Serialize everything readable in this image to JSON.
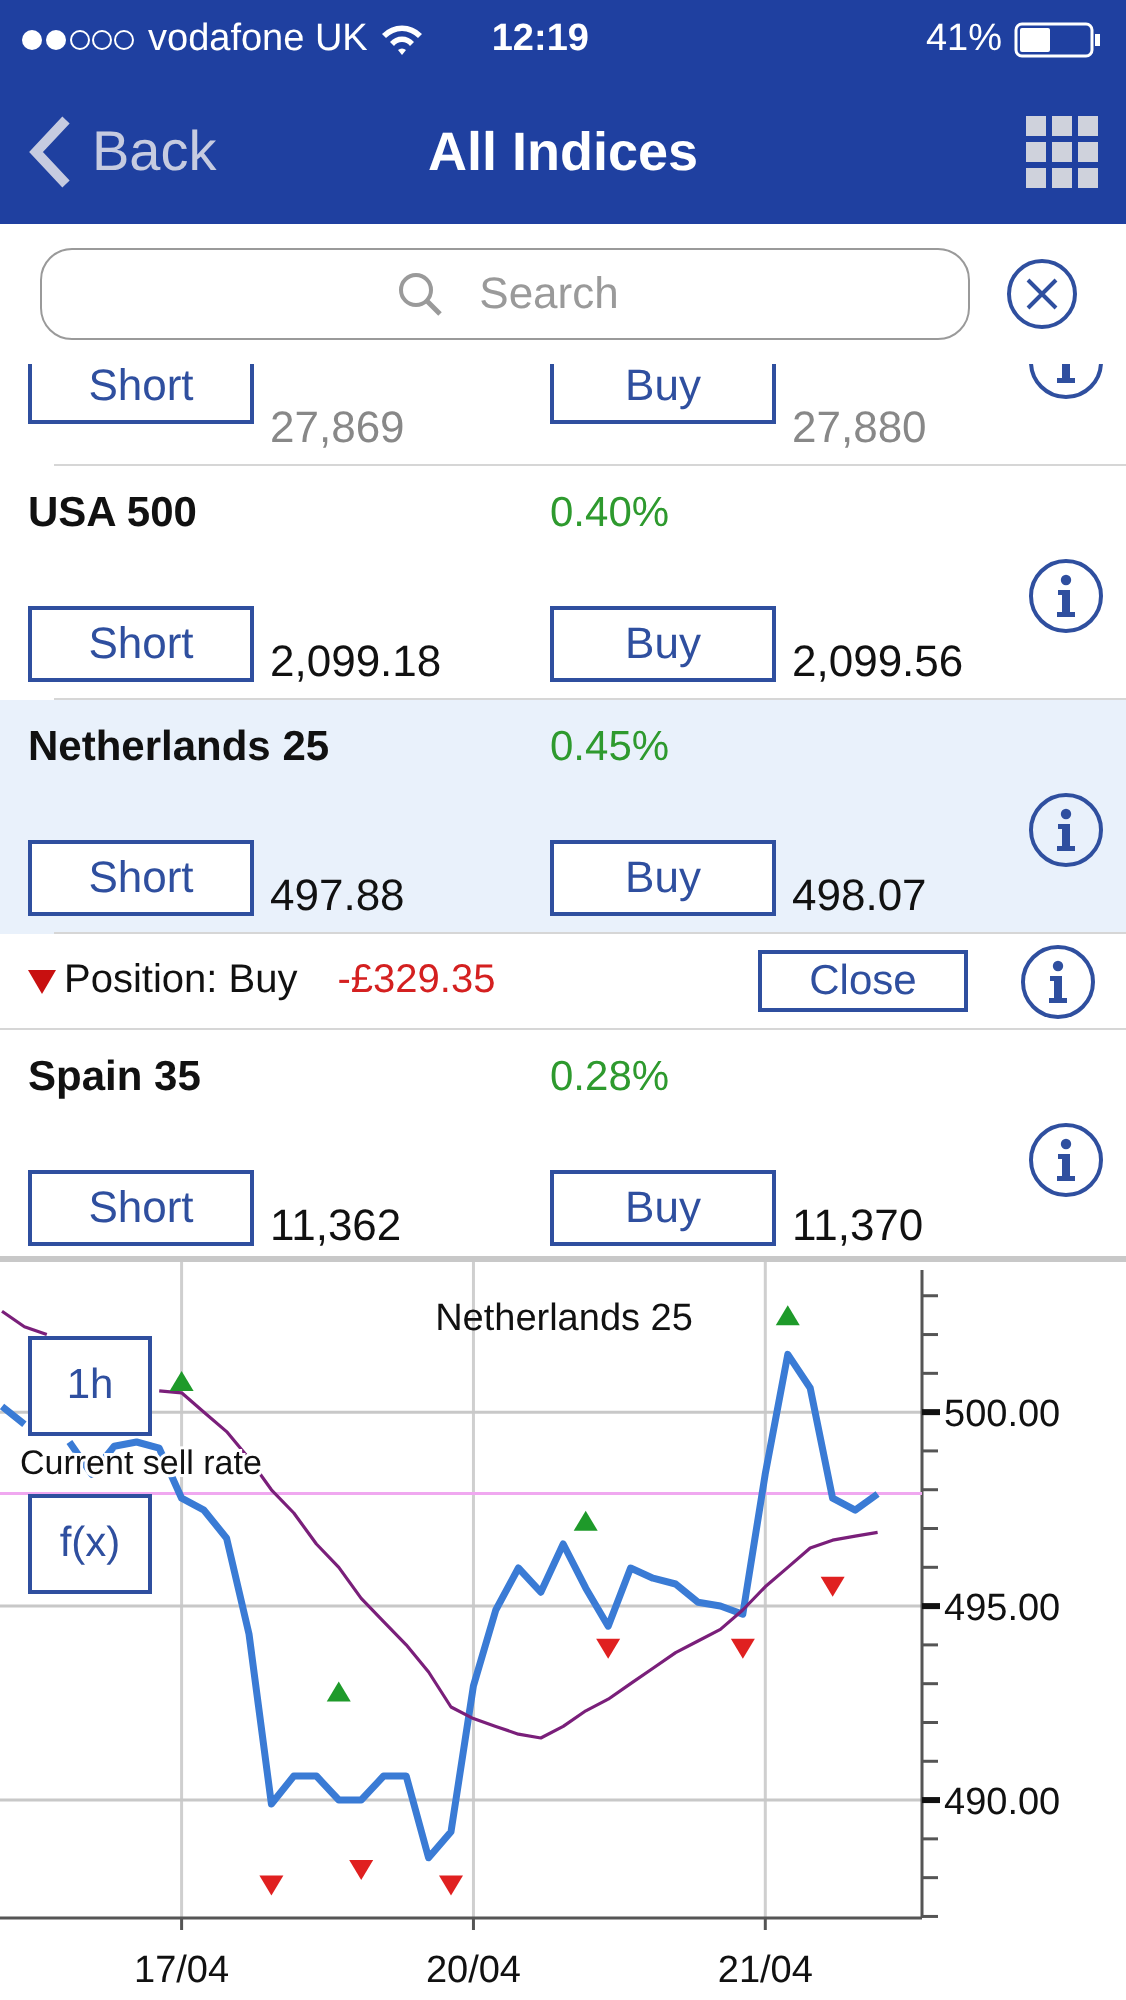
{
  "status_bar": {
    "carrier": "vodafone UK",
    "time": "12:19",
    "battery": "41%"
  },
  "nav": {
    "back": "Back",
    "title": "All Indices"
  },
  "search": {
    "placeholder": "Search"
  },
  "markets": [
    {
      "kind": "market",
      "selected": false,
      "short": "Short",
      "short_price": "27,869",
      "buy": "Buy",
      "buy_price": "27,880",
      "stale": true
    },
    {
      "kind": "market",
      "selected": false,
      "name": "USA 500",
      "change": "0.40%",
      "short": "Short",
      "short_price": "2,099.18",
      "buy": "Buy",
      "buy_price": "2,099.56",
      "stale": false
    },
    {
      "kind": "market",
      "selected": true,
      "name": "Netherlands 25",
      "change": "0.45%",
      "short": "Short",
      "short_price": "497.88",
      "buy": "Buy",
      "buy_price": "498.07",
      "stale": false
    },
    {
      "kind": "position",
      "selected": false,
      "label": "Position: Buy",
      "pnl": "-£329.35",
      "close": "Close"
    },
    {
      "kind": "market",
      "selected": false,
      "name": "Spain 35",
      "change": "0.28%",
      "short": "Short",
      "short_price": "11,362",
      "buy": "Buy",
      "buy_price": "11,370",
      "stale": false
    }
  ],
  "chart": {
    "buttons": [
      "1h",
      "f(x)"
    ],
    "chart_data": {
      "type": "line",
      "title": "Netherlands 25",
      "categories": [
        null,
        null,
        null,
        null,
        null,
        null,
        null,
        null,
        "17/04",
        null,
        null,
        null,
        null,
        null,
        null,
        null,
        null,
        null,
        null,
        null,
        null,
        "20/04",
        null,
        null,
        null,
        null,
        null,
        null,
        null,
        null,
        null,
        null,
        null,
        null,
        "21/04",
        null,
        null,
        null,
        null,
        null
      ],
      "series": [
        {
          "color": "#3a7bd5",
          "values": [
            500.15,
            499.69,
            null,
            499.23,
            498.4,
            499.12,
            499.23,
            499.07,
            497.78,
            497.47,
            496.75,
            494.28,
            489.9,
            490.62,
            490.62,
            490.0,
            490.0,
            490.62,
            490.62,
            488.51,
            489.18,
            492.94,
            494.9,
            495.98,
            495.36,
            496.6,
            495.46,
            494.48,
            495.98,
            495.72,
            495.57,
            495.1,
            495.0,
            494.79,
            498.4,
            501.49,
            500.62,
            497.78,
            497.47,
            497.89
          ]
        },
        {
          "color": "#7a1f7a",
          "values": [
            502.6,
            502.2,
            502.0,
            null,
            null,
            null,
            null,
            500.55,
            500.5,
            500.0,
            499.5,
            498.8,
            498.0,
            497.4,
            496.6,
            496.0,
            495.2,
            494.6,
            494.0,
            493.3,
            492.4,
            492.1,
            491.9,
            491.7,
            491.6,
            491.9,
            492.3,
            492.6,
            493.0,
            493.4,
            493.8,
            494.1,
            494.4,
            494.9,
            495.5,
            496.0,
            496.5,
            496.7,
            496.8,
            496.9
          ]
        },
        {
          "type": "scatter",
          "color": "#1e9a2a",
          "values": [
            null,
            null,
            null,
            null,
            null,
            null,
            null,
            null,
            500.8,
            null,
            null,
            null,
            null,
            null,
            null,
            492.8,
            null,
            null,
            null,
            null,
            null,
            null,
            null,
            null,
            null,
            null,
            497.2,
            null,
            null,
            null,
            null,
            null,
            null,
            null,
            null,
            502.5,
            null,
            null,
            null,
            null
          ]
        },
        {
          "type": "scatter",
          "color": "#e02020",
          "values": [
            null,
            null,
            null,
            null,
            null,
            null,
            null,
            null,
            null,
            null,
            null,
            null,
            487.8,
            null,
            null,
            null,
            488.2,
            null,
            null,
            null,
            487.8,
            null,
            null,
            null,
            null,
            null,
            null,
            493.9,
            null,
            null,
            null,
            null,
            null,
            493.9,
            null,
            null,
            null,
            495.5,
            null,
            null
          ]
        }
      ],
      "ylim": [
        486.96,
        503.87
      ],
      "grid": true,
      "yticks": [
        {
          "value": 490,
          "label": "490.00"
        },
        {
          "value": 495,
          "label": "495.00"
        },
        {
          "value": 500,
          "label": "500.00"
        }
      ],
      "ref_lines": [
        {
          "axis": "y",
          "value": 497.9,
          "label": "Current sell rate"
        }
      ]
    }
  }
}
